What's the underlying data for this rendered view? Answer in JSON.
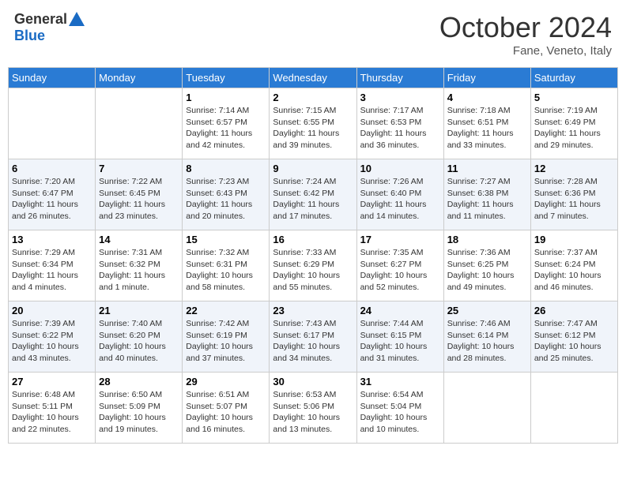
{
  "header": {
    "logo_general": "General",
    "logo_blue": "Blue",
    "month_title": "October 2024",
    "subtitle": "Fane, Veneto, Italy"
  },
  "days_of_week": [
    "Sunday",
    "Monday",
    "Tuesday",
    "Wednesday",
    "Thursday",
    "Friday",
    "Saturday"
  ],
  "weeks": [
    [
      {
        "day": "",
        "info": ""
      },
      {
        "day": "",
        "info": ""
      },
      {
        "day": "1",
        "info": "Sunrise: 7:14 AM\nSunset: 6:57 PM\nDaylight: 11 hours and 42 minutes."
      },
      {
        "day": "2",
        "info": "Sunrise: 7:15 AM\nSunset: 6:55 PM\nDaylight: 11 hours and 39 minutes."
      },
      {
        "day": "3",
        "info": "Sunrise: 7:17 AM\nSunset: 6:53 PM\nDaylight: 11 hours and 36 minutes."
      },
      {
        "day": "4",
        "info": "Sunrise: 7:18 AM\nSunset: 6:51 PM\nDaylight: 11 hours and 33 minutes."
      },
      {
        "day": "5",
        "info": "Sunrise: 7:19 AM\nSunset: 6:49 PM\nDaylight: 11 hours and 29 minutes."
      }
    ],
    [
      {
        "day": "6",
        "info": "Sunrise: 7:20 AM\nSunset: 6:47 PM\nDaylight: 11 hours and 26 minutes."
      },
      {
        "day": "7",
        "info": "Sunrise: 7:22 AM\nSunset: 6:45 PM\nDaylight: 11 hours and 23 minutes."
      },
      {
        "day": "8",
        "info": "Sunrise: 7:23 AM\nSunset: 6:43 PM\nDaylight: 11 hours and 20 minutes."
      },
      {
        "day": "9",
        "info": "Sunrise: 7:24 AM\nSunset: 6:42 PM\nDaylight: 11 hours and 17 minutes."
      },
      {
        "day": "10",
        "info": "Sunrise: 7:26 AM\nSunset: 6:40 PM\nDaylight: 11 hours and 14 minutes."
      },
      {
        "day": "11",
        "info": "Sunrise: 7:27 AM\nSunset: 6:38 PM\nDaylight: 11 hours and 11 minutes."
      },
      {
        "day": "12",
        "info": "Sunrise: 7:28 AM\nSunset: 6:36 PM\nDaylight: 11 hours and 7 minutes."
      }
    ],
    [
      {
        "day": "13",
        "info": "Sunrise: 7:29 AM\nSunset: 6:34 PM\nDaylight: 11 hours and 4 minutes."
      },
      {
        "day": "14",
        "info": "Sunrise: 7:31 AM\nSunset: 6:32 PM\nDaylight: 11 hours and 1 minute."
      },
      {
        "day": "15",
        "info": "Sunrise: 7:32 AM\nSunset: 6:31 PM\nDaylight: 10 hours and 58 minutes."
      },
      {
        "day": "16",
        "info": "Sunrise: 7:33 AM\nSunset: 6:29 PM\nDaylight: 10 hours and 55 minutes."
      },
      {
        "day": "17",
        "info": "Sunrise: 7:35 AM\nSunset: 6:27 PM\nDaylight: 10 hours and 52 minutes."
      },
      {
        "day": "18",
        "info": "Sunrise: 7:36 AM\nSunset: 6:25 PM\nDaylight: 10 hours and 49 minutes."
      },
      {
        "day": "19",
        "info": "Sunrise: 7:37 AM\nSunset: 6:24 PM\nDaylight: 10 hours and 46 minutes."
      }
    ],
    [
      {
        "day": "20",
        "info": "Sunrise: 7:39 AM\nSunset: 6:22 PM\nDaylight: 10 hours and 43 minutes."
      },
      {
        "day": "21",
        "info": "Sunrise: 7:40 AM\nSunset: 6:20 PM\nDaylight: 10 hours and 40 minutes."
      },
      {
        "day": "22",
        "info": "Sunrise: 7:42 AM\nSunset: 6:19 PM\nDaylight: 10 hours and 37 minutes."
      },
      {
        "day": "23",
        "info": "Sunrise: 7:43 AM\nSunset: 6:17 PM\nDaylight: 10 hours and 34 minutes."
      },
      {
        "day": "24",
        "info": "Sunrise: 7:44 AM\nSunset: 6:15 PM\nDaylight: 10 hours and 31 minutes."
      },
      {
        "day": "25",
        "info": "Sunrise: 7:46 AM\nSunset: 6:14 PM\nDaylight: 10 hours and 28 minutes."
      },
      {
        "day": "26",
        "info": "Sunrise: 7:47 AM\nSunset: 6:12 PM\nDaylight: 10 hours and 25 minutes."
      }
    ],
    [
      {
        "day": "27",
        "info": "Sunrise: 6:48 AM\nSunset: 5:11 PM\nDaylight: 10 hours and 22 minutes."
      },
      {
        "day": "28",
        "info": "Sunrise: 6:50 AM\nSunset: 5:09 PM\nDaylight: 10 hours and 19 minutes."
      },
      {
        "day": "29",
        "info": "Sunrise: 6:51 AM\nSunset: 5:07 PM\nDaylight: 10 hours and 16 minutes."
      },
      {
        "day": "30",
        "info": "Sunrise: 6:53 AM\nSunset: 5:06 PM\nDaylight: 10 hours and 13 minutes."
      },
      {
        "day": "31",
        "info": "Sunrise: 6:54 AM\nSunset: 5:04 PM\nDaylight: 10 hours and 10 minutes."
      },
      {
        "day": "",
        "info": ""
      },
      {
        "day": "",
        "info": ""
      }
    ]
  ]
}
